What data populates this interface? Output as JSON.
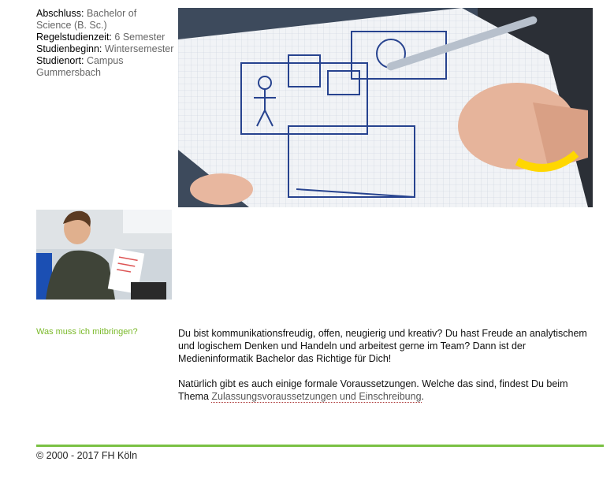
{
  "facts": [
    {
      "label": "Abschluss:",
      "value": "Bachelor of Science (B. Sc.)"
    },
    {
      "label": "Regelstudienzeit:",
      "value": "6 Semester"
    },
    {
      "label": "Studienbeginn:",
      "value": "Wintersemester"
    },
    {
      "label": "Studienort:",
      "value": "Campus Gummersbach"
    }
  ],
  "section": {
    "label": "Was muss ich mitbringen?",
    "p1": "Du bist kommunikationsfreudig, offen, neugierig und kreativ? Du hast Freude an analytischem und logischem Denken und Handeln und arbeitest gerne im Team? Dann ist der Medieninformatik Bachelor das Richtige für Dich!",
    "p2_prefix": "Natürlich gibt es auch einige formale Voraussetzungen. Welche das sind, findest Du beim Thema ",
    "p2_link": "Zulassungsvoraussetzungen und Einschreibung",
    "p2_suffix": "."
  },
  "footer": {
    "copyright": "© 2000 - 2017 FH Köln"
  },
  "colors": {
    "accent": "#7ac143",
    "label_green": "#7ab929",
    "muted": "#666666"
  }
}
